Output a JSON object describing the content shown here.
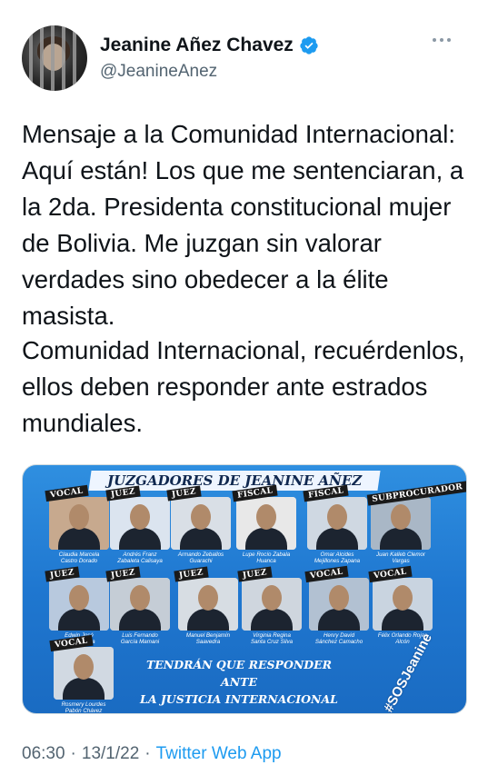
{
  "tweet": {
    "author": {
      "name": "Jeanine Añez Chavez",
      "handle": "@JeanineAnez",
      "verified": true,
      "verified_color": "#1d9bf0",
      "avatar_icon": "profile-photo"
    },
    "more_icon": "ellipsis-icon",
    "paragraphs": [
      "Mensaje a la Comunidad Internacional: Aquí están! Los que me sentenciaran, a la 2da. Presidenta constitucional mujer de Bolivia. Me juzgan sin valorar verdades sino obedecer a la élite masista.",
      "Comunidad Internacional, recuérdenlos, ellos deben responder ante estrados mundiales."
    ],
    "time": "06:30",
    "date": "13/1/22",
    "separator": "·",
    "source": "Twitter Web App"
  },
  "media": {
    "banner": "JUZGADORES DE JEANINE AÑEZ",
    "slogan_line1": "TENDRÁN QUE RESPONDER ANTE",
    "slogan_line2": "LA JUSTICIA INTERNACIONAL",
    "hashtag": "#SOSJeanine",
    "people": [
      {
        "role": "VOCAL",
        "name_line1": "Claudia Marcela",
        "name_line2": "Castro Dorado"
      },
      {
        "role": "JUEZ",
        "name_line1": "Andrés Franz",
        "name_line2": "Zabaleta Calisaya"
      },
      {
        "role": "JUEZ",
        "name_line1": "Armando Zeballos",
        "name_line2": "Guarachi"
      },
      {
        "role": "FISCAL",
        "name_line1": "Lupe Rocío Zabala",
        "name_line2": "Huanca"
      },
      {
        "role": "FISCAL",
        "name_line1": "Omar Alcides",
        "name_line2": "Mejillones Zapana"
      },
      {
        "role": "SUBPROCURADOR",
        "name_line1": "Juan Kalleb Clemor",
        "name_line2": "Vargas"
      },
      {
        "role": "JUEZ",
        "name_line1": "Edwin José",
        "name_line2": "Blanco Soria"
      },
      {
        "role": "JUEZ",
        "name_line1": "Luis Fernando",
        "name_line2": "García Mamani"
      },
      {
        "role": "JUEZ",
        "name_line1": "Manuel Benjamín",
        "name_line2": "Saavedra"
      },
      {
        "role": "JUEZ",
        "name_line1": "Virginia Regina",
        "name_line2": "Santa Cruz Silva"
      },
      {
        "role": "VOCAL",
        "name_line1": "Henry David",
        "name_line2": "Sánchez Camacho"
      },
      {
        "role": "VOCAL",
        "name_line1": "Félix Orlando Rojas",
        "name_line2": "Alcón"
      },
      {
        "role": "VOCAL",
        "name_line1": "Rosmery Lourdes",
        "name_line2": "Pabón Chávez"
      }
    ]
  }
}
